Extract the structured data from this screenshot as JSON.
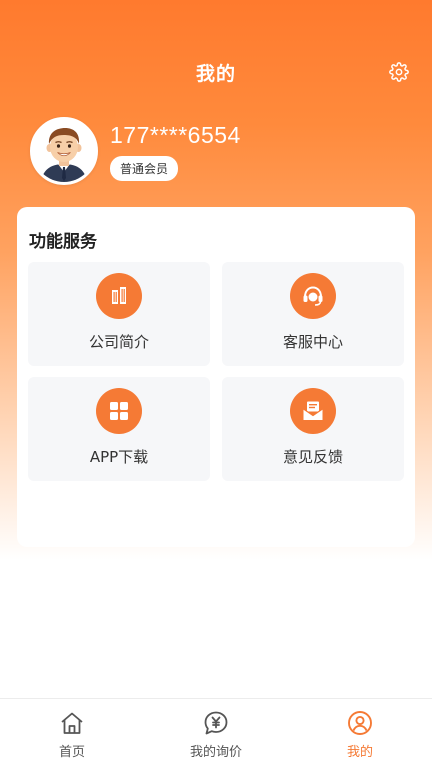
{
  "header": {
    "title": "我的",
    "settings_icon": "gear-icon"
  },
  "profile": {
    "phone": "177****6554",
    "member_level": "普通会员",
    "avatar_icon": "user-avatar-icon"
  },
  "services": {
    "title": "功能服务",
    "items": [
      {
        "label": "公司简介",
        "icon": "building-icon"
      },
      {
        "label": "客服中心",
        "icon": "headset-icon"
      },
      {
        "label": "APP下载",
        "icon": "app-grid-icon"
      },
      {
        "label": "意见反馈",
        "icon": "mail-icon"
      }
    ]
  },
  "tabbar": {
    "items": [
      {
        "label": "首页",
        "icon": "home-icon",
        "active": false
      },
      {
        "label": "我的询价",
        "icon": "yen-chat-icon",
        "active": false
      },
      {
        "label": "我的",
        "icon": "user-icon",
        "active": true
      }
    ]
  },
  "colors": {
    "accent": "#f57a35",
    "hero_top": "#ff7a2e",
    "tile_bg": "#f6f7f9"
  }
}
